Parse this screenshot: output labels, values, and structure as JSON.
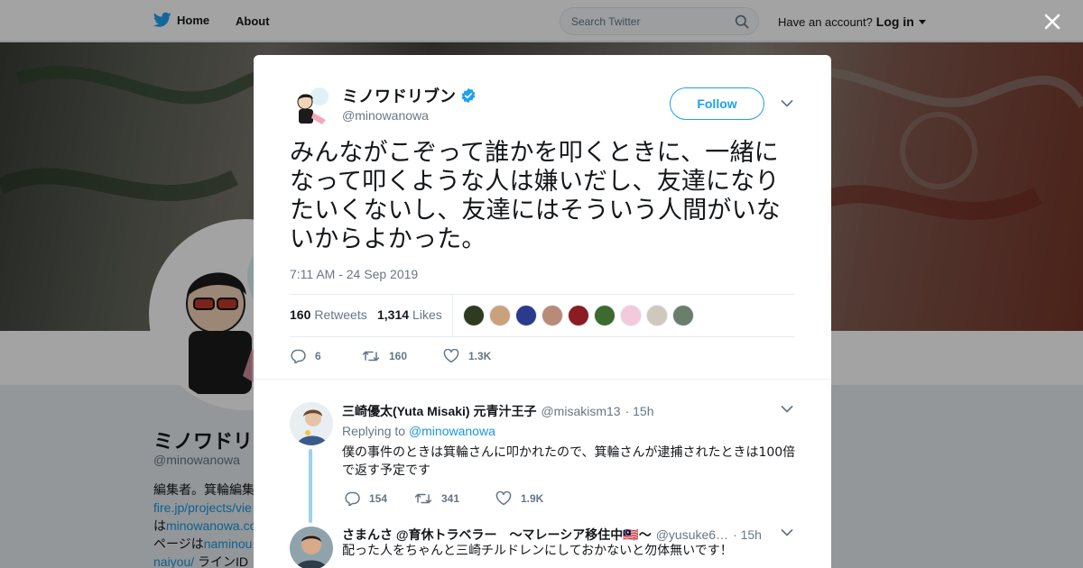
{
  "topnav": {
    "home_label": "Home",
    "about_label": "About",
    "search_placeholder": "Search Twitter",
    "account_prompt": "Have an account?",
    "login_label": "Log in"
  },
  "profile": {
    "name": "ミノワドリ",
    "handle": "@minowanowa",
    "bio_lines": [
      {
        "text": "編集者。箕輪編集",
        "link": false
      },
      {
        "text": "fire.jp/projects/vie",
        "link": true
      }
    ],
    "bio_line3_prefix": "は",
    "bio_line3_link": "minowanowa.co",
    "bio_line4_prefix": "ページは",
    "bio_line4_link": "naminou",
    "bio_line5_link": "naiyou/",
    "bio_line5_suffix": " ラインID"
  },
  "tweet": {
    "author_name": "ミノワドリブン",
    "author_handle": "@minowanowa",
    "verified": true,
    "follow_label": "Follow",
    "text": "みんながこぞって誰かを叩くときに、一緒になって叩くような人は嫌いだし、友達になりたいくないし、友達にはそういう人間がいないからよかった。",
    "timestamp": "7:11 AM - 24 Sep 2019",
    "retweets_count": "160",
    "retweets_label": "Retweets",
    "likes_count": "1,314",
    "likes_label": "Likes",
    "liker_colors": [
      "#2e3b1f",
      "#c9a27c",
      "#2b3a8a",
      "#b88a77",
      "#8a1c22",
      "#3d6a2e",
      "#f3c9dc",
      "#cfc8bd",
      "#6b7d6b"
    ],
    "actions": {
      "reply": "6",
      "retweet": "160",
      "like": "1.3K"
    }
  },
  "replies": [
    {
      "name": "三崎優太(Yuta Misaki) 元青汁王子",
      "handle": "@misakism13",
      "time": "· 15h",
      "replying_prefix": "Replying to",
      "replying_to": "@minowanowa",
      "text": "僕の事件のときは箕輪さんに叩かれたので、箕輪さんが逮捕されたときは100倍で返す予定です",
      "actions": {
        "reply": "154",
        "retweet": "341",
        "like": "1.9K"
      }
    },
    {
      "name": "さまんさ @育休トラベラー　〜マレーシア移住中🇲🇾〜",
      "handle": "@yusuke6…",
      "time": "· 15h",
      "text": "配った人をちゃんと三崎チルドレンにしておかないと勿体無いです！"
    }
  ],
  "colors": {
    "accent": "#1da1f2",
    "link": "#1b95e0",
    "muted": "#657786",
    "text": "#14171a",
    "verified": "#1da1f2"
  }
}
